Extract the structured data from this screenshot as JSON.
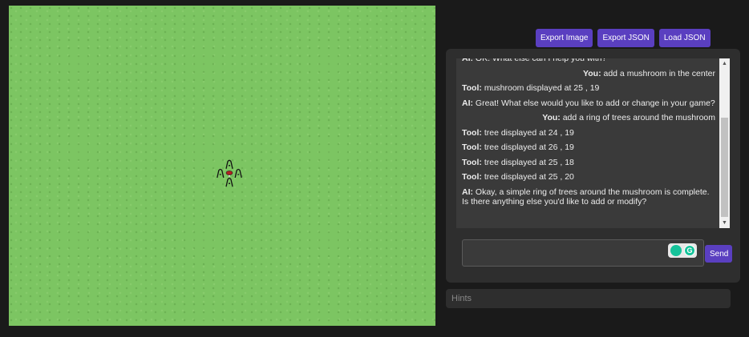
{
  "toolbar": {
    "export_image": "Export Image",
    "export_json": "Export JSON",
    "load_json": "Load JSON"
  },
  "chat": {
    "messages": [
      {
        "speaker": "AI:",
        "text": "OK. What else can I help you with?",
        "side": "left"
      },
      {
        "speaker": "You:",
        "text": "add a mushroom in the center",
        "side": "right"
      },
      {
        "speaker": "Tool:",
        "text": "mushroom displayed at 25 , 19",
        "side": "left"
      },
      {
        "speaker": "AI:",
        "text": "Great! What else would you like to add or change in your game?",
        "side": "left"
      },
      {
        "speaker": "You:",
        "text": "add a ring of trees around the mushroom",
        "side": "right"
      },
      {
        "speaker": "Tool:",
        "text": "tree displayed at 24 , 19",
        "side": "left"
      },
      {
        "speaker": "Tool:",
        "text": "tree displayed at 26 , 19",
        "side": "left"
      },
      {
        "speaker": "Tool:",
        "text": "tree displayed at 25 , 18",
        "side": "left"
      },
      {
        "speaker": "Tool:",
        "text": "tree displayed at 25 , 20",
        "side": "left"
      },
      {
        "speaker": "AI:",
        "text": "Okay, a simple ring of trees around the mushroom is complete. Is there anything else you'd like to add or modify?",
        "side": "left"
      }
    ],
    "input_value": "",
    "send_label": "Send",
    "grammarly_letter": "G"
  },
  "hints": {
    "placeholder": "Hints"
  },
  "canvas": {
    "background_color": "#7cc562",
    "sprites": [
      {
        "type": "mushroom",
        "grid": [
          25,
          19
        ]
      },
      {
        "type": "tree",
        "grid": [
          24,
          19
        ]
      },
      {
        "type": "tree",
        "grid": [
          26,
          19
        ]
      },
      {
        "type": "tree",
        "grid": [
          25,
          18
        ]
      },
      {
        "type": "tree",
        "grid": [
          25,
          20
        ]
      }
    ]
  },
  "colors": {
    "accent": "#5a3fc0",
    "page_bg": "#1a1a1a",
    "panel_bg": "#2e2e2e"
  }
}
